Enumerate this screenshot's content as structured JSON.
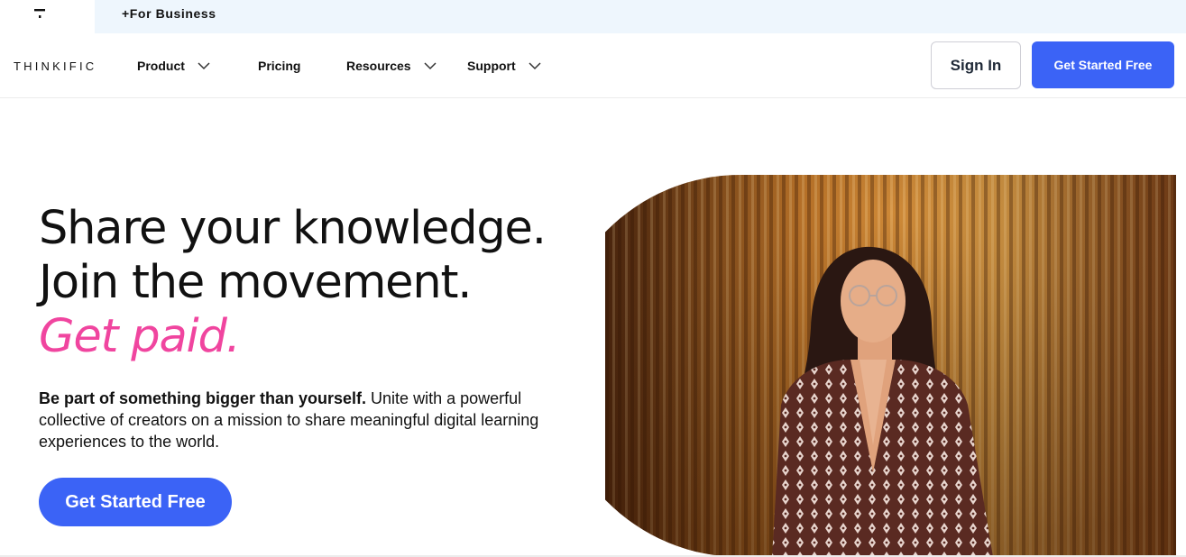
{
  "topbar": {
    "home_icon": "thinkific-mark-icon",
    "business_label": "+For Business"
  },
  "nav": {
    "logo": "THINKIFIC",
    "items": [
      {
        "label": "Product",
        "has_dropdown": true
      },
      {
        "label": "Pricing",
        "has_dropdown": false
      },
      {
        "label": "Resources",
        "has_dropdown": true
      },
      {
        "label": "Support",
        "has_dropdown": true
      }
    ],
    "sign_in": "Sign In",
    "get_started": "Get Started Free"
  },
  "hero": {
    "line1": "Share your knowledge.",
    "line2": "Join the movement.",
    "line3": "Get paid.",
    "sub_bold": "Be part of something bigger than yourself.",
    "sub_rest": " Unite with a powerful collective of creators on a mission to share meaningful digital learning experiences to the world.",
    "cta": "Get Started Free"
  },
  "colors": {
    "accent_blue": "#3b63f6",
    "accent_pink": "#f0459f",
    "strip_bg": "#eef6fd"
  }
}
